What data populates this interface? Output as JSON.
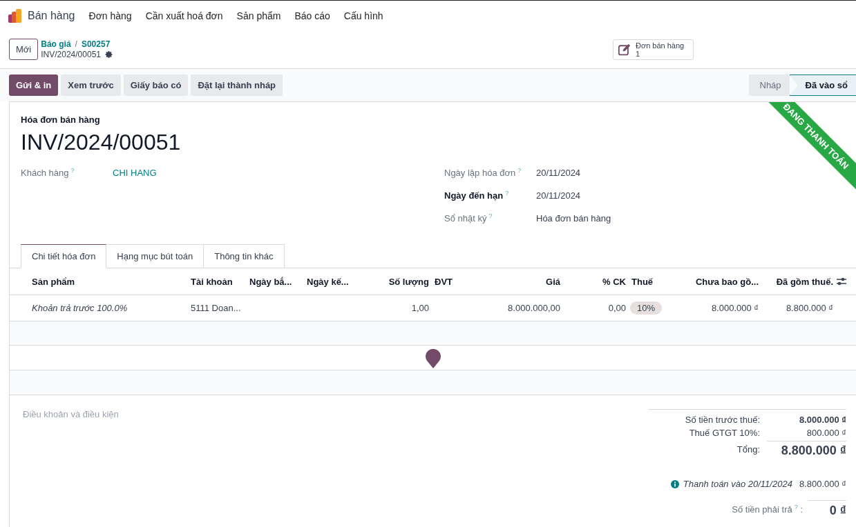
{
  "navbar": {
    "app_name": "Bán hàng",
    "menu": [
      "Đơn hàng",
      "Cần xuất hoá đơn",
      "Sản phẩm",
      "Báo cáo",
      "Cấu hình"
    ]
  },
  "control_panel": {
    "new_button": "Mới",
    "breadcrumbs": [
      "Báo giá",
      "S00257"
    ],
    "breadcrumb_separator": "/",
    "record_name": "INV/2024/00051",
    "smart_button": {
      "label": "Đơn bán hàng",
      "count": "1"
    }
  },
  "actions": [
    {
      "label": "Gửi & in",
      "primary": true
    },
    {
      "label": "Xem trước",
      "primary": false
    },
    {
      "label": "Giấy báo có",
      "primary": false
    },
    {
      "label": "Đặt lại thành nháp",
      "primary": false
    }
  ],
  "status_bar": [
    {
      "label": "Nháp",
      "selected": false
    },
    {
      "label": "Đã vào sổ",
      "selected": true
    }
  ],
  "ribbon": "ĐANG THANH TOÁN",
  "sheet": {
    "subtitle": "Hóa đơn bán hàng",
    "title": "INV/2024/00051",
    "left_fields": [
      {
        "label": "Khách hàng",
        "help": "?",
        "value": "CHI HANG",
        "link": true,
        "emphasized": false
      }
    ],
    "right_fields": [
      {
        "label": "Ngày lập hóa đơn",
        "help": "?",
        "value": "20/11/2024",
        "link": false,
        "emphasized": false
      },
      {
        "label": "Ngày đến hạn",
        "help": "?",
        "value": "20/11/2024",
        "link": false,
        "emphasized": true
      },
      {
        "label": "Sổ nhật ký",
        "help": "?",
        "value": "Hóa đơn bán hàng",
        "link": false,
        "emphasized": false
      }
    ]
  },
  "tabs": [
    {
      "label": "Chi tiết hóa đơn",
      "selected": true
    },
    {
      "label": "Hạng mục bút toán",
      "selected": false
    },
    {
      "label": "Thông tin khác",
      "selected": false
    }
  ],
  "table": {
    "columns": [
      {
        "label": "Sản phẩm",
        "numeric": false
      },
      {
        "label": "Tài khoản",
        "numeric": false
      },
      {
        "label": "Ngày bắ...",
        "numeric": false
      },
      {
        "label": "Ngày kế...",
        "numeric": false
      },
      {
        "label": "Số lượng",
        "numeric": true
      },
      {
        "label": "ĐVT",
        "numeric": false
      },
      {
        "label": "Giá",
        "numeric": true
      },
      {
        "label": "% CK",
        "numeric": true
      },
      {
        "label": "Thuế",
        "numeric": false
      },
      {
        "label": "Chưa bao gồ...",
        "numeric": true
      },
      {
        "label": "Đã gồm thuế.",
        "numeric": true
      }
    ],
    "rows": [
      {
        "cells": [
          {
            "kind": "italic",
            "text": "Khoản trả trước 100.0%"
          },
          {
            "kind": "text",
            "text": "5111 Doan..."
          },
          {
            "kind": "empty"
          },
          {
            "kind": "empty"
          },
          {
            "kind": "text",
            "text": "1,00"
          },
          {
            "kind": "empty"
          },
          {
            "kind": "text",
            "text": "8.000.000,00"
          },
          {
            "kind": "text",
            "text": "0,00"
          },
          {
            "kind": "tag",
            "text": "10%"
          },
          {
            "kind": "money",
            "text": "8.000.000 ₫"
          },
          {
            "kind": "money",
            "text": "8.800.000 ₫"
          }
        ]
      }
    ]
  },
  "terms_placeholder": "Điều khoản và điều kiện",
  "totals": {
    "lines": [
      {
        "label": "Số tiền trước thuế:",
        "value": "8.000.000 ₫",
        "kind": "bold"
      },
      {
        "label": "Thuế GTGT 10%:",
        "value": "800.000 ₫",
        "kind": "normal"
      },
      {
        "label": "Tổng:",
        "value": "8.800.000 ₫",
        "kind": "total"
      }
    ],
    "payment": {
      "label": "Thanh toán vào 20/11/2024",
      "value": "8.800.000 ₫"
    },
    "due": {
      "label": "Số tiền phải trả",
      "help": "?",
      "colon": ":",
      "value": "0 ₫"
    }
  }
}
